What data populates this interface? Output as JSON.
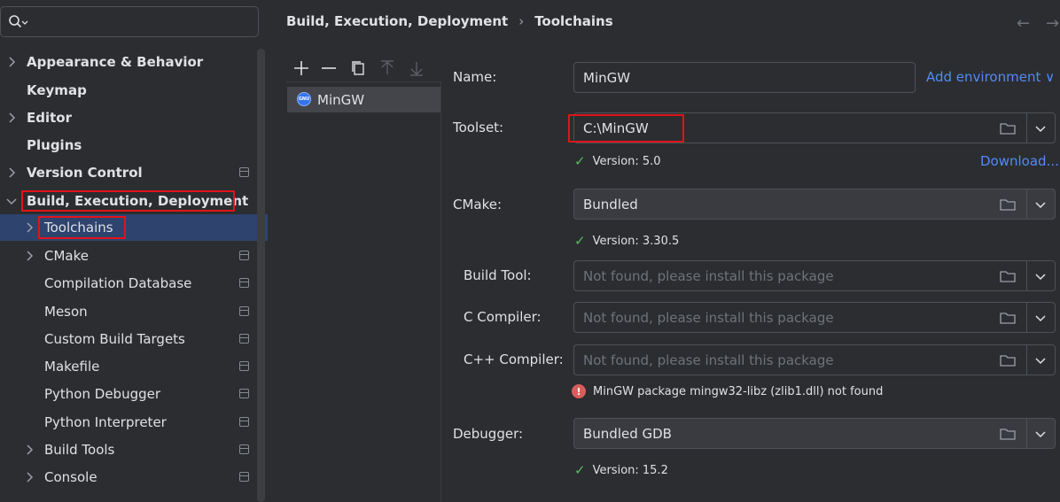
{
  "search": {
    "placeholder": ""
  },
  "sidebar": {
    "items": [
      {
        "label": "Appearance & Behavior"
      },
      {
        "label": "Keymap"
      },
      {
        "label": "Editor"
      },
      {
        "label": "Plugins"
      },
      {
        "label": "Version Control"
      },
      {
        "label": "Build, Execution, Deployment"
      },
      {
        "label": "Toolchains"
      },
      {
        "label": "CMake"
      },
      {
        "label": "Compilation Database"
      },
      {
        "label": "Meson"
      },
      {
        "label": "Custom Build Targets"
      },
      {
        "label": "Makefile"
      },
      {
        "label": "Python Debugger"
      },
      {
        "label": "Python Interpreter"
      },
      {
        "label": "Build Tools"
      },
      {
        "label": "Console"
      }
    ]
  },
  "breadcrumb": {
    "parent": "Build, Execution, Deployment",
    "separator": "›",
    "current": "Toolchains"
  },
  "nav": {
    "back": "←",
    "forward": "→"
  },
  "toolchains": {
    "items": [
      {
        "label": "MinGW",
        "icon_text": "GNU"
      }
    ]
  },
  "form": {
    "name": {
      "label": "Name:",
      "value": "MinGW"
    },
    "add_environment": "Add environment ∨",
    "toolset": {
      "label": "Toolset:",
      "value": "C:\\MinGW",
      "status": "Version: 5.0",
      "download": "Download..."
    },
    "cmake": {
      "label": "CMake:",
      "value": "Bundled",
      "status": "Version: 3.30.5"
    },
    "build_tool": {
      "label": "Build Tool:",
      "placeholder": "Not found, please install this package"
    },
    "c_compiler": {
      "label": "C Compiler:",
      "placeholder": "Not found, please install this package"
    },
    "cpp_compiler": {
      "label": "C++ Compiler:",
      "placeholder": "Not found, please install this package"
    },
    "error": "MinGW package mingw32-libz (zlib1.dll) not found",
    "debugger": {
      "label": "Debugger:",
      "value": "Bundled GDB",
      "status": "Version: 15.2"
    }
  },
  "colors": {
    "accent_link": "#548af7",
    "selection": "#2e436e",
    "highlight_box": "#e0141a",
    "ok": "#5fb865",
    "error": "#db5c5c"
  }
}
